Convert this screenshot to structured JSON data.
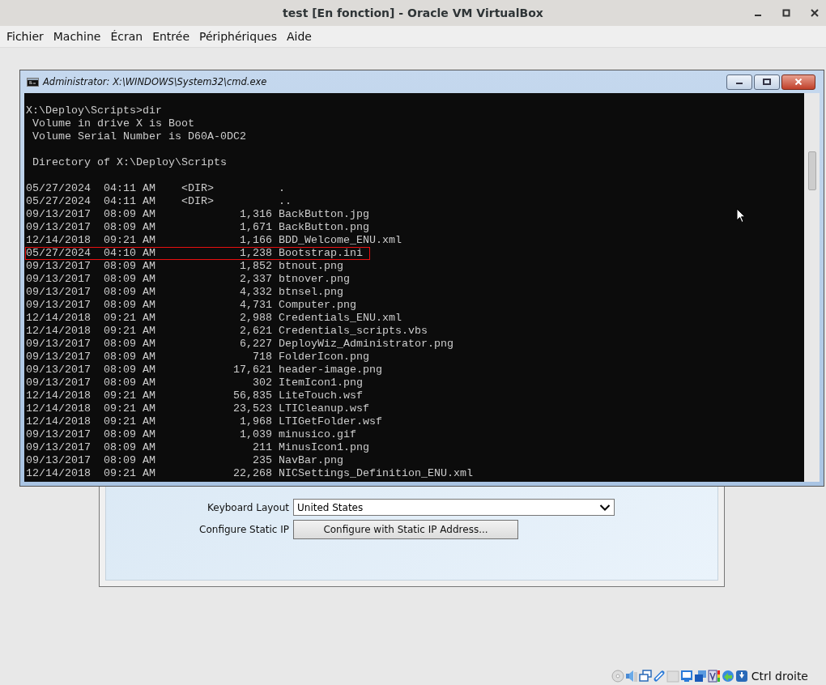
{
  "window": {
    "title": "test [En fonction] - Oracle VM VirtualBox"
  },
  "menu": [
    "Fichier",
    "Machine",
    "Écran",
    "Entrée",
    "Périphériques",
    "Aide"
  ],
  "guest": {
    "dialog": {
      "fields": [
        {
          "kind": "dropdown",
          "label": "Keyboard Layout",
          "value": "United States"
        },
        {
          "kind": "button",
          "label": "Configure Static IP",
          "button": "Configure with Static IP Address..."
        }
      ]
    },
    "cmd_window": {
      "title": "Administrator: X:\\WINDOWS\\System32\\cmd.exe",
      "lines": [
        {
          "kind": "text",
          "text": "X:\\Deploy\\Scripts>dir",
          "highlighted": false
        },
        {
          "kind": "text",
          "text": " Volume in drive X is Boot",
          "highlighted": false
        },
        {
          "kind": "text",
          "text": " Volume Serial Number is D60A-0DC2",
          "highlighted": false
        },
        {
          "kind": "blank"
        },
        {
          "kind": "text",
          "text": " Directory of X:\\Deploy\\Scripts",
          "highlighted": false
        },
        {
          "kind": "blank"
        },
        {
          "kind": "text",
          "text": "05/27/2024  04:11 AM    <DIR>          .",
          "highlighted": false
        },
        {
          "kind": "text",
          "text": "05/27/2024  04:11 AM    <DIR>          ..",
          "highlighted": false
        },
        {
          "kind": "text",
          "text": "09/13/2017  08:09 AM             1,316 BackButton.jpg",
          "highlighted": false
        },
        {
          "kind": "text",
          "text": "09/13/2017  08:09 AM             1,671 BackButton.png",
          "highlighted": false
        },
        {
          "kind": "text",
          "text": "12/14/2018  09:21 AM             1,166 BDD_Welcome_ENU.xml",
          "highlighted": false
        },
        {
          "kind": "text",
          "text": "05/27/2024  04:10 AM             1,238 Bootstrap.ini",
          "highlighted": true
        },
        {
          "kind": "text",
          "text": "09/13/2017  08:09 AM             1,852 btnout.png",
          "highlighted": false
        },
        {
          "kind": "text",
          "text": "09/13/2017  08:09 AM             2,337 btnover.png",
          "highlighted": false
        },
        {
          "kind": "text",
          "text": "09/13/2017  08:09 AM             4,332 btnsel.png",
          "highlighted": false
        },
        {
          "kind": "text",
          "text": "09/13/2017  08:09 AM             4,731 Computer.png",
          "highlighted": false
        },
        {
          "kind": "text",
          "text": "12/14/2018  09:21 AM             2,988 Credentials_ENU.xml",
          "highlighted": false
        },
        {
          "kind": "text",
          "text": "12/14/2018  09:21 AM             2,621 Credentials_scripts.vbs",
          "highlighted": false
        },
        {
          "kind": "text",
          "text": "09/13/2017  08:09 AM             6,227 DeployWiz_Administrator.png",
          "highlighted": false
        },
        {
          "kind": "text",
          "text": "09/13/2017  08:09 AM               718 FolderIcon.png",
          "highlighted": false
        },
        {
          "kind": "text",
          "text": "09/13/2017  08:09 AM            17,621 header-image.png",
          "highlighted": false
        },
        {
          "kind": "text",
          "text": "09/13/2017  08:09 AM               302 ItemIcon1.png",
          "highlighted": false
        },
        {
          "kind": "text",
          "text": "12/14/2018  09:21 AM            56,835 LiteTouch.wsf",
          "highlighted": false
        },
        {
          "kind": "text",
          "text": "12/14/2018  09:21 AM            23,523 LTICleanup.wsf",
          "highlighted": false
        },
        {
          "kind": "text",
          "text": "12/14/2018  09:21 AM             1,968 LTIGetFolder.wsf",
          "highlighted": false
        },
        {
          "kind": "text",
          "text": "09/13/2017  08:09 AM             1,039 minusico.gif",
          "highlighted": false
        },
        {
          "kind": "text",
          "text": "09/13/2017  08:09 AM               211 MinusIcon1.png",
          "highlighted": false
        },
        {
          "kind": "text",
          "text": "09/13/2017  08:09 AM               235 NavBar.png",
          "highlighted": false
        },
        {
          "kind": "text",
          "text": "12/14/2018  09:21 AM            22,268 NICSettings_Definition_ENU.xml",
          "highlighted": false
        }
      ]
    }
  },
  "status_bar": {
    "host_key": "Ctrl droite"
  }
}
